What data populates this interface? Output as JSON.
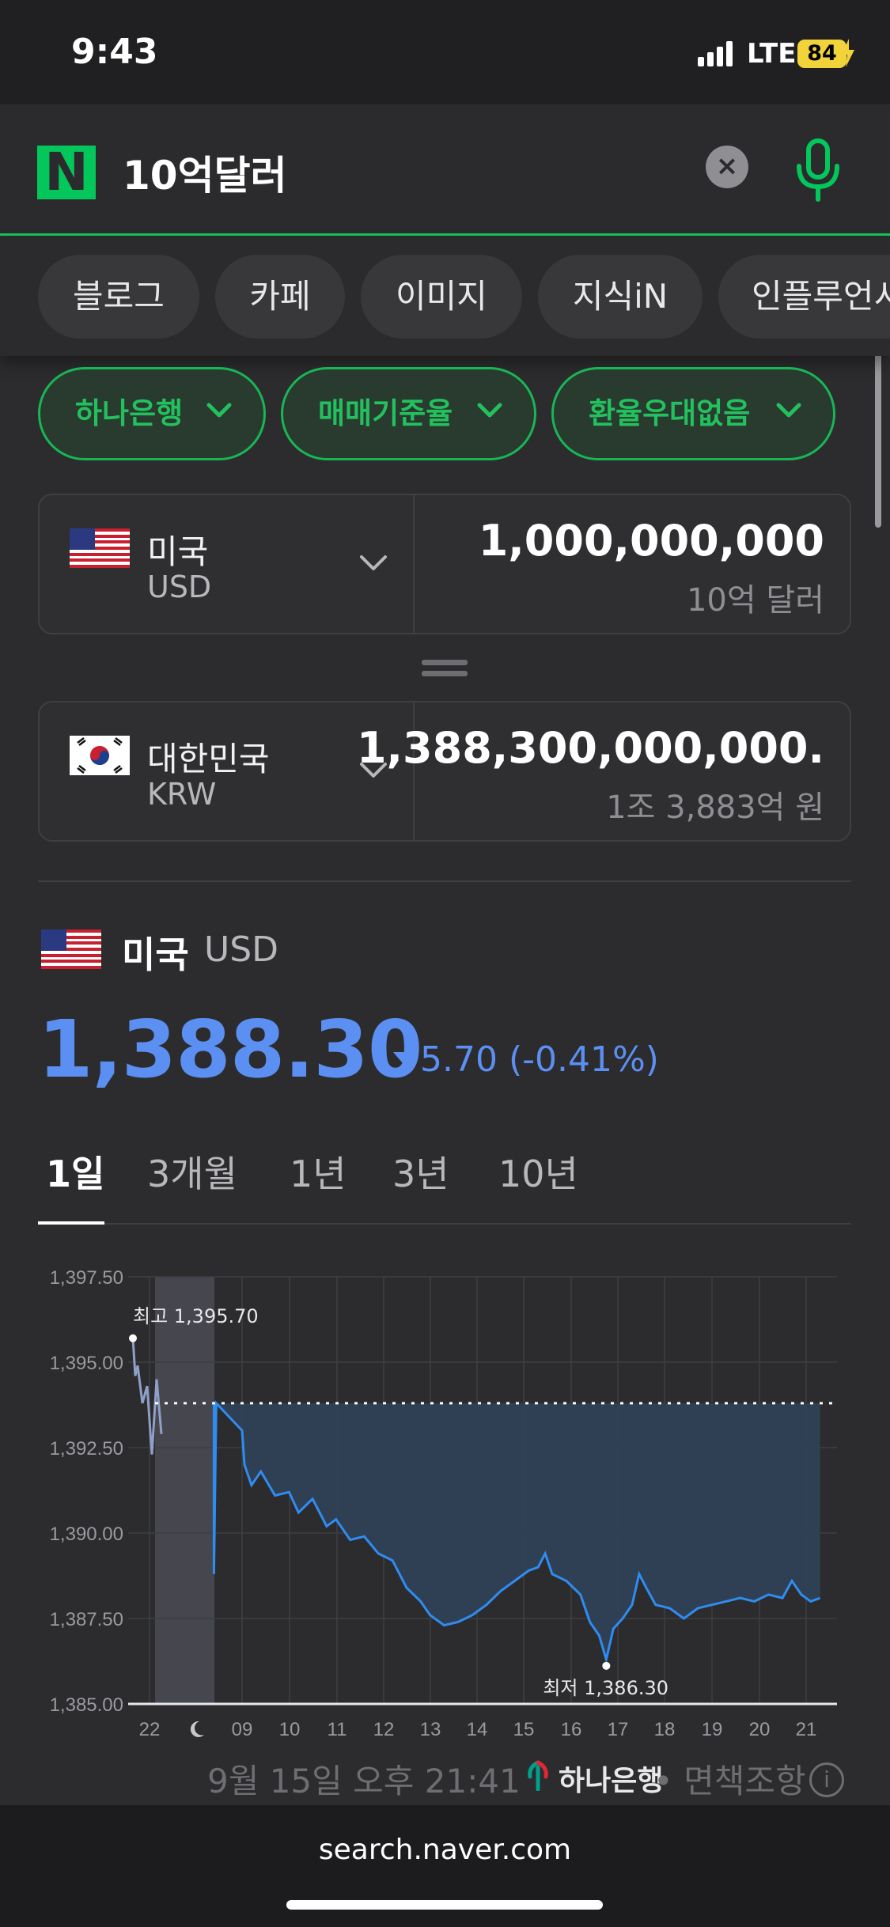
{
  "status_bar": {
    "time": "9:43",
    "network": "LTE",
    "battery": "84"
  },
  "search": {
    "logo": "N",
    "query": "10억달러",
    "clear_icon": "close-icon",
    "mic_icon": "mic-icon"
  },
  "tabs": [
    "블로그",
    "카페",
    "이미지",
    "지식iN",
    "인플루언서"
  ],
  "filters": [
    "하나은행",
    "매매기준율",
    "환율우대없음"
  ],
  "converter": {
    "from": {
      "country": "미국",
      "code": "USD",
      "amount": "1,000,000,000",
      "words": "10억 달러"
    },
    "to": {
      "country": "대한민국",
      "code": "KRW",
      "amount": "1,388,300,000,000.",
      "words": "1조 3,883억 원"
    }
  },
  "rate": {
    "country": "미국",
    "code": "USD",
    "value": "1,388.30",
    "change": "5.70 (-0.41%)",
    "direction": "down"
  },
  "period_tabs": [
    "1일",
    "3개월",
    "1년",
    "3년",
    "10년"
  ],
  "active_period": "1일",
  "chart_data": {
    "type": "line",
    "x_tick_labels": [
      "22",
      "09",
      "10",
      "11",
      "12",
      "13",
      "14",
      "15",
      "16",
      "17",
      "18",
      "19",
      "20",
      "21"
    ],
    "y_tick_labels": [
      "1,397.50",
      "1,395.00",
      "1,392.50",
      "1,390.00",
      "1,387.50",
      "1,385.00"
    ],
    "ylim": [
      1385.0,
      1397.5
    ],
    "reference_line": 1393.8,
    "high_label": "최고 1,395.70",
    "low_label": "최저 1,386.30",
    "high": 1395.7,
    "low": 1386.3,
    "series": [
      {
        "values": [
          [
            21.8,
            1395.7
          ],
          [
            21.85,
            1394.6
          ],
          [
            21.9,
            1394.9
          ],
          [
            22.0,
            1393.8
          ],
          [
            22.1,
            1394.3
          ],
          [
            22.2,
            1392.3
          ],
          [
            22.3,
            1394.5
          ],
          [
            22.4,
            1392.9
          ],
          [
            8.4,
            1393.8
          ],
          [
            8.4,
            1388.8
          ],
          [
            8.45,
            1393.8
          ],
          [
            9.0,
            1393.0
          ],
          [
            9.05,
            1392.0
          ],
          [
            9.2,
            1391.4
          ],
          [
            9.4,
            1391.8
          ],
          [
            9.7,
            1391.1
          ],
          [
            10.0,
            1391.2
          ],
          [
            10.2,
            1390.6
          ],
          [
            10.5,
            1391.0
          ],
          [
            10.8,
            1390.2
          ],
          [
            11.0,
            1390.4
          ],
          [
            11.3,
            1389.8
          ],
          [
            11.6,
            1389.9
          ],
          [
            11.9,
            1389.4
          ],
          [
            12.2,
            1389.2
          ],
          [
            12.5,
            1388.4
          ],
          [
            12.8,
            1388.0
          ],
          [
            13.0,
            1387.6
          ],
          [
            13.3,
            1387.3
          ],
          [
            13.6,
            1387.4
          ],
          [
            13.9,
            1387.6
          ],
          [
            14.2,
            1387.9
          ],
          [
            14.5,
            1388.3
          ],
          [
            14.8,
            1388.6
          ],
          [
            15.1,
            1388.9
          ],
          [
            15.3,
            1389.0
          ],
          [
            15.45,
            1389.4
          ],
          [
            15.6,
            1388.8
          ],
          [
            15.9,
            1388.6
          ],
          [
            16.2,
            1388.2
          ],
          [
            16.4,
            1387.4
          ],
          [
            16.6,
            1387.0
          ],
          [
            16.75,
            1386.3
          ],
          [
            16.9,
            1387.2
          ],
          [
            17.1,
            1387.5
          ],
          [
            17.3,
            1387.9
          ],
          [
            17.45,
            1388.8
          ],
          [
            17.6,
            1388.4
          ],
          [
            17.8,
            1387.9
          ],
          [
            18.1,
            1387.8
          ],
          [
            18.4,
            1387.5
          ],
          [
            18.7,
            1387.8
          ],
          [
            19.0,
            1387.9
          ],
          [
            19.3,
            1388.0
          ],
          [
            19.6,
            1388.1
          ],
          [
            19.9,
            1388.0
          ],
          [
            20.2,
            1388.2
          ],
          [
            20.5,
            1388.1
          ],
          [
            20.7,
            1388.6
          ],
          [
            20.9,
            1388.2
          ],
          [
            21.1,
            1388.0
          ],
          [
            21.3,
            1388.1
          ]
        ]
      }
    ]
  },
  "footer": {
    "timestamp": "9월 15일 오후 21:41",
    "bank": "하나은행",
    "disclaimer": "• 면책조항"
  },
  "browser": {
    "url": "search.naver.com"
  }
}
